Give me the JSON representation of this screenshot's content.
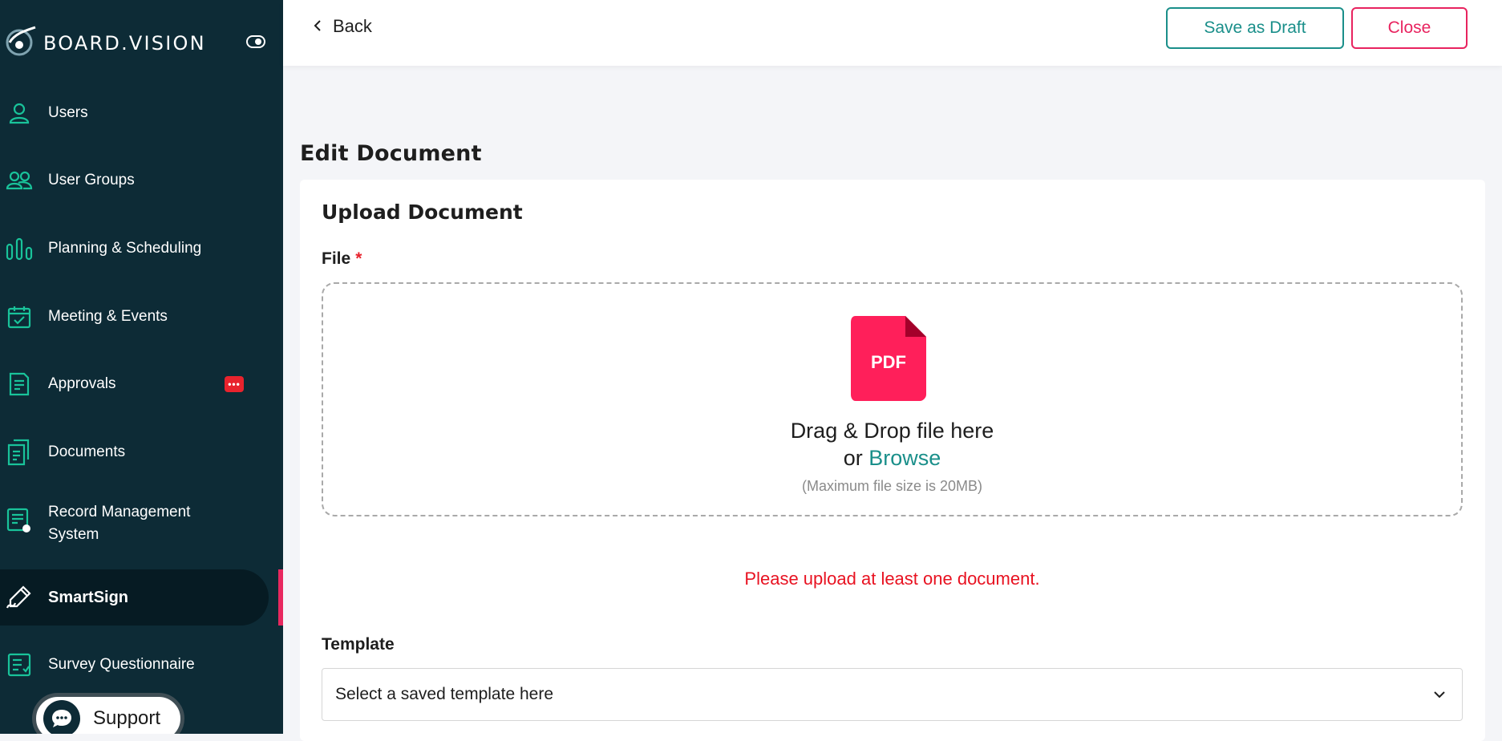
{
  "brand": {
    "name": "BOARD.VISION"
  },
  "sidebar": {
    "items": [
      {
        "label": "Users",
        "icon": "user-icon"
      },
      {
        "label": "User Groups",
        "icon": "user-group-icon"
      },
      {
        "label": "Planning & Scheduling",
        "icon": "bar-columns-icon"
      },
      {
        "label": "Meeting & Events",
        "icon": "calendar-check-icon"
      },
      {
        "label": "Approvals",
        "icon": "document-lines-icon",
        "badge": "•••"
      },
      {
        "label": "Documents",
        "icon": "documents-stack-icon"
      },
      {
        "label": "Record Management System",
        "label_line1": "Record Management",
        "label_line2": "System",
        "icon": "record-icon"
      },
      {
        "label": "SmartSign",
        "icon": "pen-signature-icon",
        "active": true
      },
      {
        "label": "Survey Questionnaire",
        "icon": "checklist-icon"
      }
    ],
    "support_label": "Support"
  },
  "topbar": {
    "back_label": "Back",
    "save_draft_label": "Save as Draft",
    "close_label": "Close"
  },
  "page": {
    "title": "Edit Document",
    "card_title": "Upload Document",
    "file_label": "File",
    "required_mark": "*",
    "dropzone": {
      "icon_text": "PDF",
      "line1": "Drag & Drop file here",
      "or_text": "or",
      "browse_label": "Browse",
      "hint": "(Maximum file size is 20MB)"
    },
    "error_message": "Please upload at least one document.",
    "template_label": "Template",
    "template_placeholder": "Select a saved template here"
  },
  "colors": {
    "sidebar_bg": "#0d2b36",
    "accent_teal": "#1a8f8a",
    "icon_green": "#19c39a",
    "danger": "#e8235f",
    "error_red": "#e81221",
    "pdf_red": "#ff1f5a"
  }
}
